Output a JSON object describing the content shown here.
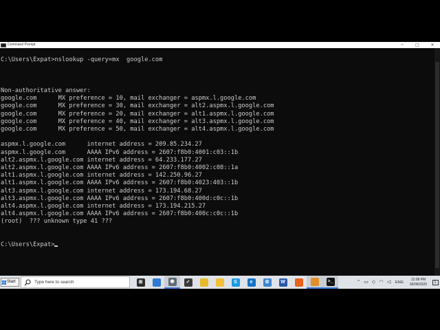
{
  "window": {
    "title": "Command Prompt",
    "controls": {
      "minimize": "─",
      "maximize": "□",
      "close": "✕"
    }
  },
  "console": {
    "lines": [
      "",
      "C:\\Users\\Expat>nslookup -query=mx  google.com",
      "",
      "",
      "",
      "Non-authoritative answer:",
      "google.com      MX preference = 10, mail exchanger = aspmx.l.google.com",
      "google.com      MX preference = 30, mail exchanger = alt2.aspmx.l.google.com",
      "google.com      MX preference = 20, mail exchanger = alt1.aspmx.l.google.com",
      "google.com      MX preference = 40, mail exchanger = alt3.aspmx.l.google.com",
      "google.com      MX preference = 50, mail exchanger = alt4.aspmx.l.google.com",
      "",
      "aspmx.l.google.com      internet address = 209.85.234.27",
      "aspmx.l.google.com      AAAA IPv6 address = 2607:f8b0:4001:c03::1b",
      "alt2.aspmx.l.google.com internet address = 64.233.177.27",
      "alt2.aspmx.l.google.com AAAA IPv6 address = 2607:f8b0:4002:c08::1a",
      "alt1.aspmx.l.google.com internet address = 142.250.96.27",
      "alt1.aspmx.l.google.com AAAA IPv6 address = 2607:f8b0:4023:403::1b",
      "alt3.aspmx.l.google.com internet address = 173.194.68.27",
      "alt3.aspmx.l.google.com AAAA IPv6 address = 2607:f8b0:400d:c0c::1b",
      "alt4.aspmx.l.google.com internet address = 173.194.215.27",
      "alt4.aspmx.l.google.com AAAA IPv6 address = 2607:f8b0:400c:c0c::1b",
      "(root)  ??? unknown type 41 ???",
      "",
      ""
    ],
    "prompt": "C:\\Users\\Expat>"
  },
  "taskbar": {
    "start_label": "Start",
    "search_placeholder": "Type here to search",
    "apps": [
      {
        "name": "task-view",
        "icon": "task-view-icon",
        "glyph": "⊞",
        "color": "#2b2b2b",
        "active": false
      },
      {
        "name": "file-explorer-blue",
        "icon": "folder-icon",
        "glyph": "",
        "color": "#2f7ad6",
        "active": false
      },
      {
        "name": "screen-recorder",
        "icon": "record-icon",
        "glyph": "◉",
        "color": "#5f6b78",
        "active": true
      },
      {
        "name": "shield-app",
        "icon": "shield-icon",
        "glyph": "✓",
        "color": "#3a3a3a",
        "active": false
      },
      {
        "name": "chrome",
        "icon": "chrome-icon",
        "glyph": "",
        "color": "#e9b92c",
        "active": false
      },
      {
        "name": "file-explorer",
        "icon": "file-explorer-icon",
        "glyph": "",
        "color": "#f3c03c",
        "active": false
      },
      {
        "name": "skype",
        "icon": "skype-icon",
        "glyph": "S",
        "color": "#1a9be6",
        "active": false
      },
      {
        "name": "edge",
        "icon": "edge-icon",
        "glyph": "e",
        "color": "#1673c9",
        "active": false
      },
      {
        "name": "settings",
        "icon": "gear-icon",
        "glyph": "⚙",
        "color": "#3b87d1",
        "active": false
      },
      {
        "name": "word",
        "icon": "word-icon",
        "glyph": "W",
        "color": "#2a5aa8",
        "active": false
      },
      {
        "name": "firefox",
        "icon": "firefox-icon",
        "glyph": "",
        "color": "#e8601c",
        "active": false
      },
      {
        "name": "app-orange",
        "icon": "package-icon",
        "glyph": "",
        "color": "#e0902a",
        "active": true
      },
      {
        "name": "command-prompt",
        "icon": "terminal-icon",
        "glyph": ">_",
        "color": "#111111",
        "active": true
      }
    ],
    "tray": {
      "lang": "ENG",
      "time": "12:08 PM",
      "date": "06/08/2020"
    }
  }
}
